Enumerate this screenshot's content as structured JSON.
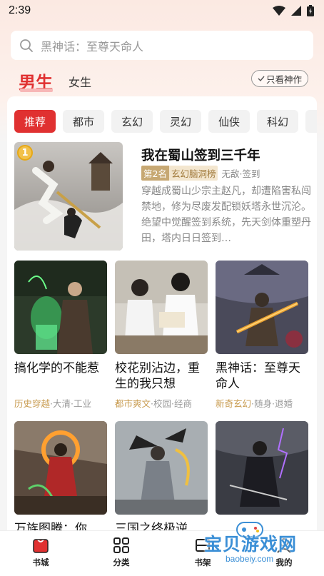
{
  "status_bar": {
    "time": "2:39"
  },
  "search": {
    "placeholder": "黑神话：至尊天命人"
  },
  "gender_tabs": {
    "male": "男生",
    "female": "女生"
  },
  "filter": {
    "only_watch_label": "只看神作"
  },
  "categories": [
    "推荐",
    "都市",
    "玄幻",
    "灵幻",
    "仙侠",
    "科幻"
  ],
  "featured_book": {
    "rank": "1",
    "title": "我在蜀山签到三千年",
    "rank_tag": "第2名",
    "list_tag": "玄幻脑洞榜",
    "extra_tags": "无敌·签到",
    "description": "穿越成蜀山少宗主赵凡，却遭陷害私闯禁地，修为尽废发配锁妖塔永世沉沦。绝望中觉醒签到系统，先天剑体重塑丹田，塔内日日签到…"
  },
  "books_row1": [
    {
      "title": "搞化学的不能惹",
      "main_tag": "历史穿越",
      "tags": "·大清·工业"
    },
    {
      "title": "校花别沾边，重生的我只想",
      "main_tag": "都市爽文",
      "tags": "·校园·经商"
    },
    {
      "title": "黑神话：至尊天命人",
      "main_tag": "新奇玄幻",
      "tags": "·随身·退婚"
    }
  ],
  "books_row2": [
    {
      "title": "万族图腾：你"
    },
    {
      "title": "三国之终极逆"
    },
    {
      "title": ""
    }
  ],
  "bottom_nav": {
    "bookstore": "书城",
    "categories": "分类",
    "bookshelf": "书架",
    "mine": "我的"
  },
  "watermark": {
    "text": "宝贝游戏网",
    "url": "baobeiy.com"
  },
  "colors": {
    "accent": "#e03131",
    "tag_gold": "#c89b4f"
  }
}
